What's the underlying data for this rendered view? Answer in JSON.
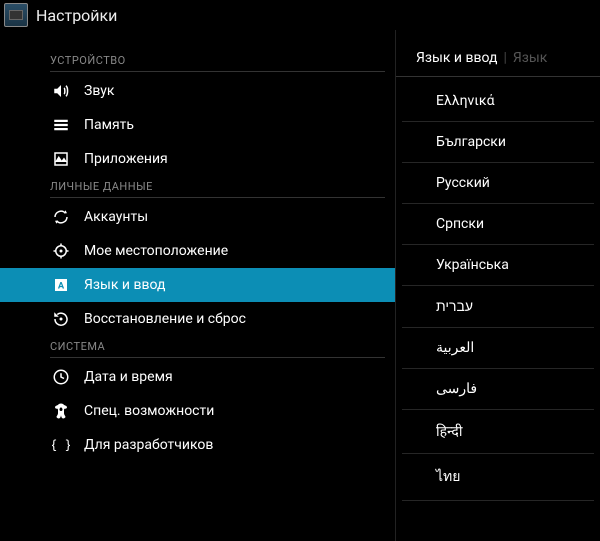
{
  "topbar": {
    "title": "Настройки"
  },
  "left": {
    "sections": [
      {
        "header": "УСТРОЙСТВО",
        "items": [
          {
            "icon": "volume",
            "label": "Звук",
            "selected": false
          },
          {
            "icon": "storage",
            "label": "Память",
            "selected": false
          },
          {
            "icon": "apps",
            "label": "Приложения",
            "selected": false
          }
        ]
      },
      {
        "header": "ЛИЧНЫЕ ДАННЫЕ",
        "items": [
          {
            "icon": "sync",
            "label": "Аккаунты",
            "selected": false
          },
          {
            "icon": "location",
            "label": "Мое местоположение",
            "selected": false
          },
          {
            "icon": "language",
            "label": "Язык и ввод",
            "selected": true
          },
          {
            "icon": "restore",
            "label": "Восстановление и сброс",
            "selected": false
          }
        ]
      },
      {
        "header": "СИСТЕМА",
        "items": [
          {
            "icon": "clock",
            "label": "Дата и время",
            "selected": false
          },
          {
            "icon": "accessibility",
            "label": "Спец. возможности",
            "selected": false
          },
          {
            "icon": "developer",
            "label": "Для разработчиков",
            "selected": false
          }
        ]
      }
    ]
  },
  "right": {
    "title": "Язык и ввод",
    "breadcrumb": "Язык",
    "languages": [
      "Ελληνικά",
      "Български",
      "Русский",
      "Српски",
      "Українська",
      "עברית",
      "العربية",
      "فارسی",
      "हिन्दी",
      "ไทย"
    ]
  }
}
